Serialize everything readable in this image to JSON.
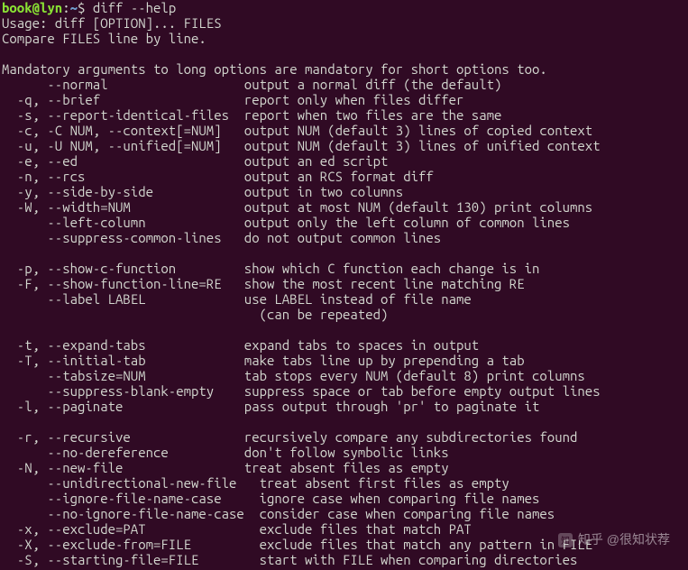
{
  "prompt": {
    "user": "book@lyn",
    "sep1": ":",
    "path": "~",
    "sep2": "$ ",
    "command": "diff --help"
  },
  "lines": [
    "Usage: diff [OPTION]... FILES",
    "Compare FILES line by line.",
    "",
    "Mandatory arguments to long options are mandatory for short options too.",
    "      --normal                  output a normal diff (the default)",
    "  -q, --brief                   report only when files differ",
    "  -s, --report-identical-files  report when two files are the same",
    "  -c, -C NUM, --context[=NUM]   output NUM (default 3) lines of copied context",
    "  -u, -U NUM, --unified[=NUM]   output NUM (default 3) lines of unified context",
    "  -e, --ed                      output an ed script",
    "  -n, --rcs                     output an RCS format diff",
    "  -y, --side-by-side            output in two columns",
    "  -W, --width=NUM               output at most NUM (default 130) print columns",
    "      --left-column             output only the left column of common lines",
    "      --suppress-common-lines   do not output common lines",
    "",
    "  -p, --show-c-function         show which C function each change is in",
    "  -F, --show-function-line=RE   show the most recent line matching RE",
    "      --label LABEL             use LABEL instead of file name",
    "                                  (can be repeated)",
    "",
    "  -t, --expand-tabs             expand tabs to spaces in output",
    "  -T, --initial-tab             make tabs line up by prepending a tab",
    "      --tabsize=NUM             tab stops every NUM (default 8) print columns",
    "      --suppress-blank-empty    suppress space or tab before empty output lines",
    "  -l, --paginate                pass output through 'pr' to paginate it",
    "",
    "  -r, --recursive               recursively compare any subdirectories found",
    "      --no-dereference          don't follow symbolic links",
    "  -N, --new-file                treat absent files as empty",
    "      --unidirectional-new-file   treat absent first files as empty",
    "      --ignore-file-name-case     ignore case when comparing file names",
    "      --no-ignore-file-name-case  consider case when comparing file names",
    "  -x, --exclude=PAT               exclude files that match PAT",
    "  -X, --exclude-from=FILE         exclude files that match any pattern in FILE",
    "  -S, --starting-file=FILE        start with FILE when comparing directories"
  ],
  "watermark": "知乎 @很知状荐"
}
